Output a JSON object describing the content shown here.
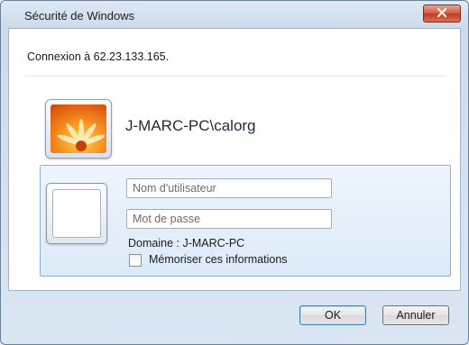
{
  "window": {
    "title": "Sécurité de Windows"
  },
  "header": {
    "connection_text": "Connexion à 62.23.133.165."
  },
  "saved_account": {
    "username": "J-MARC-PC\\calorg"
  },
  "credentials": {
    "username_placeholder": "Nom d'utilisateur",
    "password_placeholder": "Mot de passe",
    "domain_text": "Domaine : J-MARC-PC",
    "remember_label": "Mémoriser ces informations",
    "remember_checked": false
  },
  "buttons": {
    "ok": "OK",
    "cancel": "Annuler"
  },
  "icons": {
    "close": "close-icon",
    "flower_avatar": "flower-avatar-icon",
    "blank_avatar": "blank-avatar-icon"
  },
  "colors": {
    "close_button": "#c4391d",
    "accent": "#3c7fb1"
  }
}
